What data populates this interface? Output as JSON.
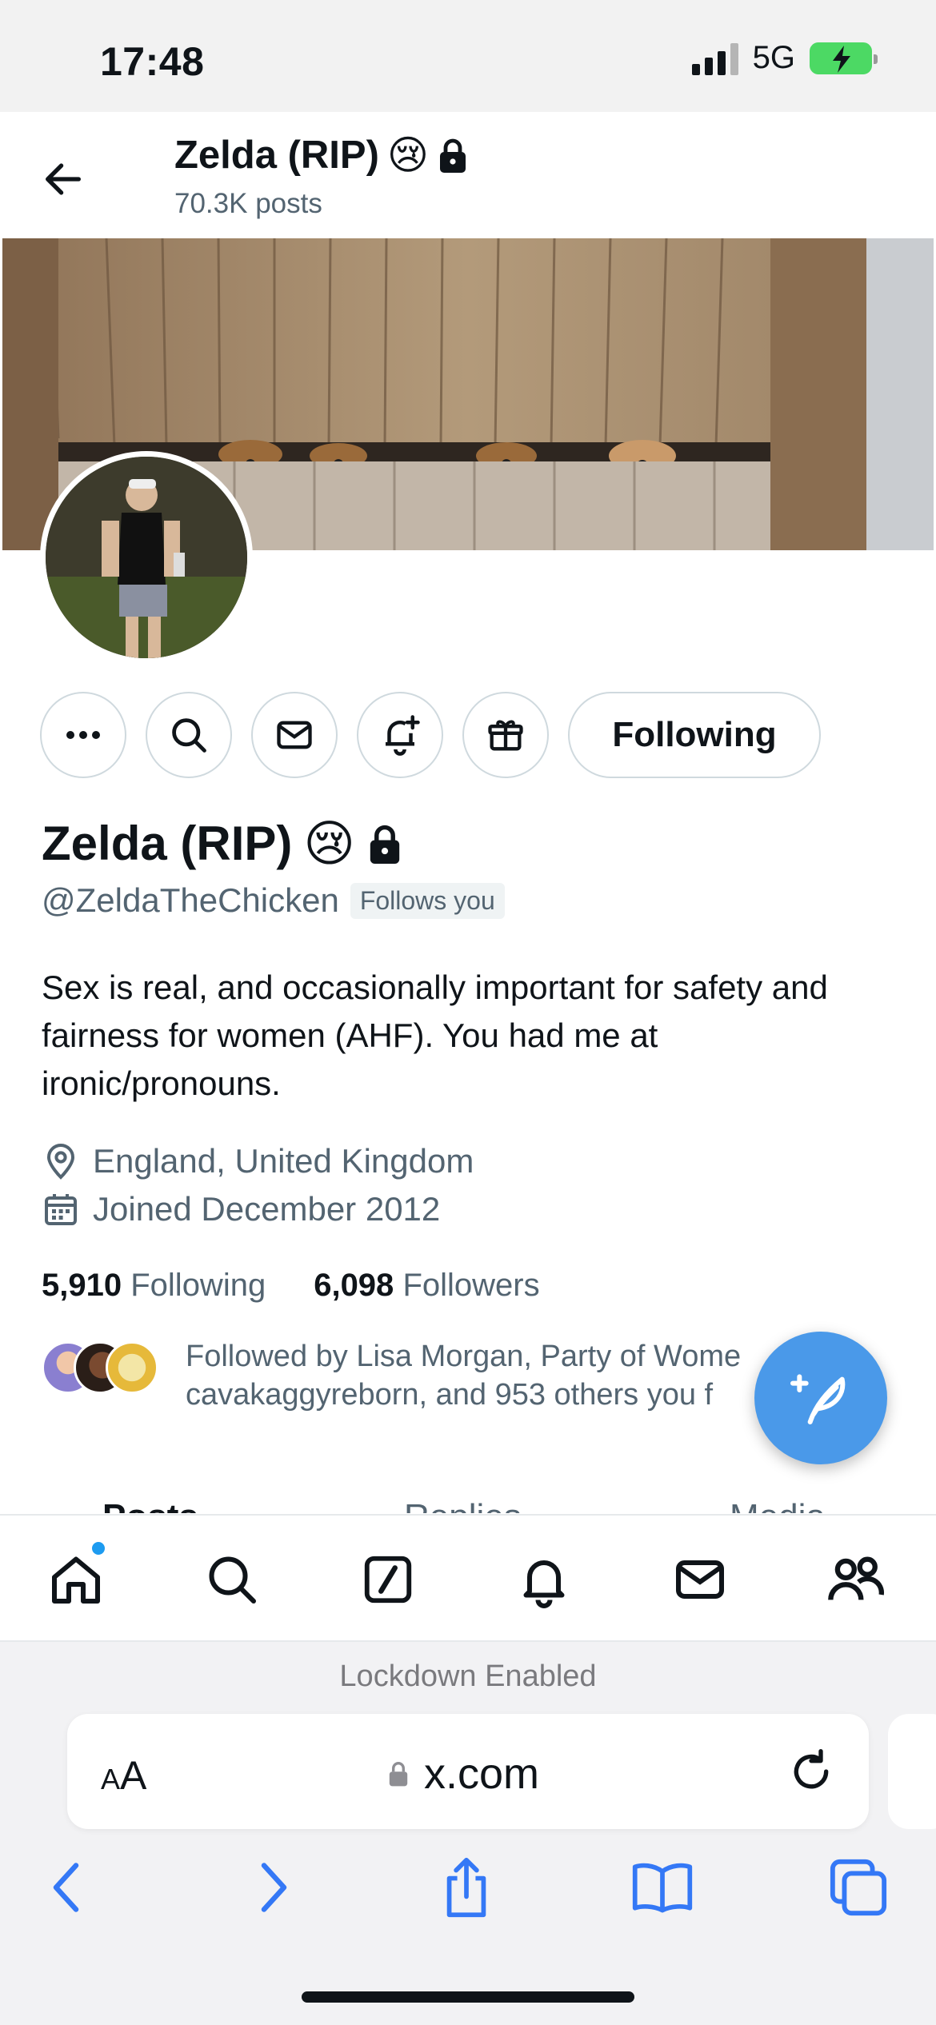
{
  "status_bar": {
    "time": "17:48",
    "network": "5G"
  },
  "header": {
    "title": "Zelda (RIP)",
    "emoji": "😢",
    "post_count": "70.3K posts"
  },
  "profile": {
    "name": "Zelda (RIP)",
    "emoji": "😢",
    "handle": "@ZeldaTheChicken",
    "follows_you": "Follows you",
    "bio": "Sex is real, and occasionally important for safety and fairness for women (AHF). You had me at ironic/pronouns.",
    "location": "England, United Kingdom",
    "joined": "Joined December 2012",
    "following_count": "5,910",
    "following_label": "Following",
    "followers_count": "6,098",
    "followers_label": "Followers",
    "followed_by_line1": "Followed by Lisa Morgan, Party of Wome",
    "followed_by_line2": "cavakaggyreborn, and 953 others you f"
  },
  "actions": {
    "following_button": "Following",
    "icons": [
      "more-icon",
      "search-icon",
      "message-icon",
      "notification-add-icon",
      "gift-icon"
    ]
  },
  "tabs": [
    "Posts",
    "Replies",
    "Media"
  ],
  "bottom_nav": [
    "home-icon",
    "search-icon",
    "grok-icon",
    "bell-icon",
    "mail-icon",
    "communities-icon"
  ],
  "safari": {
    "lockdown": "Lockdown Enabled",
    "aa_label_small": "A",
    "aa_label_large": "A",
    "url": "x.com"
  },
  "colors": {
    "accent": "#1d9bf0",
    "fab": "#4a99e9",
    "safari_blue": "#3478f6",
    "muted": "#536471"
  }
}
